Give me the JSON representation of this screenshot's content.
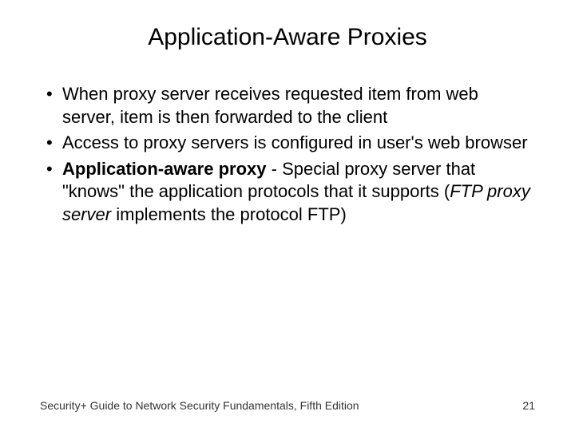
{
  "title": "Application-Aware Proxies",
  "bullets": {
    "b1": "When proxy server receives requested item from web server, item is then forwarded to the client",
    "b2": "Access to proxy servers is configured in user's web browser",
    "b3_bold": "Application-aware proxy",
    "b3_mid": " - Special proxy server that \"knows\" the application protocols that it supports (",
    "b3_italic": "FTP proxy server",
    "b3_tail": " implements the protocol FTP)"
  },
  "footer": {
    "left": "Security+ Guide to Network Security Fundamentals, Fifth Edition",
    "right": "21"
  }
}
